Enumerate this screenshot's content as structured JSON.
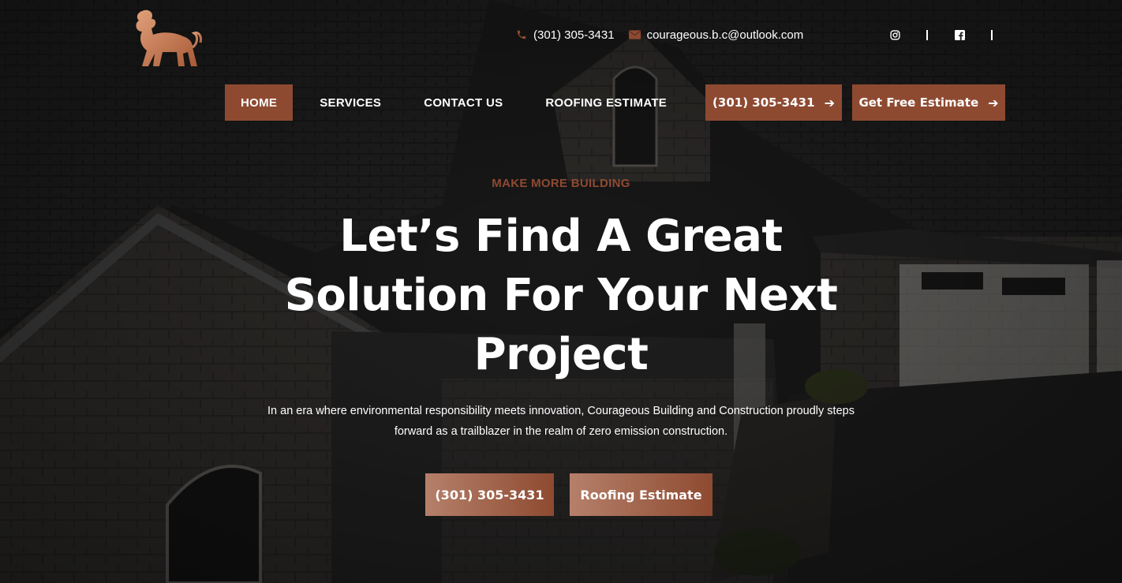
{
  "brand": {
    "logo_icon": "lion-icon",
    "accent_color": "#8e4a31"
  },
  "topbar": {
    "phone": "(301) 305-3431",
    "email": "courageous.b.c@outlook.com",
    "socials": [
      "instagram-icon",
      "facebook-icon"
    ]
  },
  "nav": {
    "items": [
      {
        "label": "HOME",
        "active": true
      },
      {
        "label": "SERVICES",
        "active": false
      },
      {
        "label": "CONTACT US",
        "active": false
      },
      {
        "label": "ROOFING ESTIMATE",
        "active": false
      }
    ],
    "cta_phone": "(301) 305-3431",
    "cta_estimate": "Get Free Estimate"
  },
  "hero": {
    "eyebrow": "MAKE MORE BUILDING",
    "headline_line1": "Let’s Find A Great",
    "headline_line2": "Solution For Your Next",
    "headline_line3": "Project",
    "description": "In an era where environmental responsibility meets innovation, Courageous Building and Construction proudly steps forward as a trailblazer in the realm of zero emission construction.",
    "button_phone": "(301) 305-3431",
    "button_estimate": "Roofing Estimate"
  }
}
